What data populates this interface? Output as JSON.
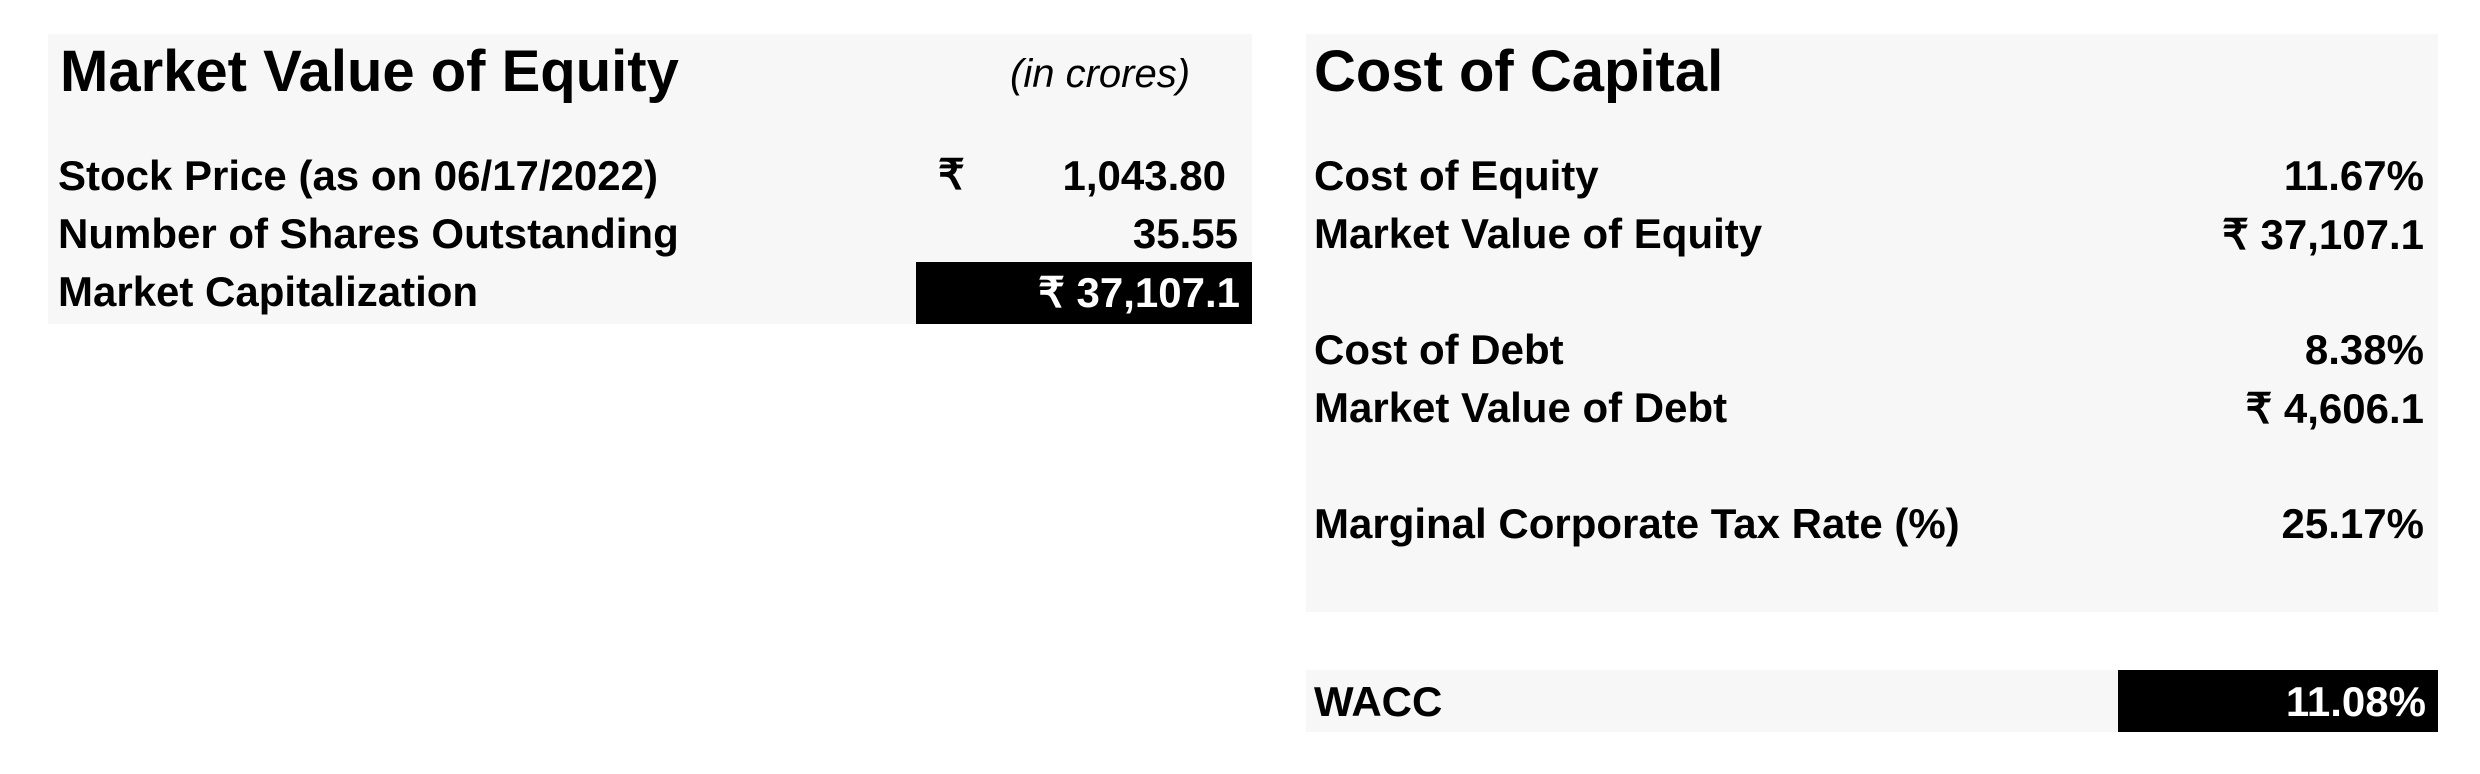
{
  "equity": {
    "title": "Market Value of Equity",
    "unit_note": "(in crores)",
    "rows": [
      {
        "label": "Stock Price (as on 06/17/2022)",
        "currency": "₹",
        "value": "1,043.80"
      },
      {
        "label": "Number of Shares Outstanding",
        "value": "35.55"
      },
      {
        "label": "Market Capitalization",
        "value": "₹ 37,107.1"
      }
    ]
  },
  "capital": {
    "title": "Cost of Capital",
    "rows": [
      {
        "label": "Cost of Equity",
        "value": "11.67%"
      },
      {
        "label": "Market Value of Equity",
        "value": "₹ 37,107.1"
      },
      {
        "label": "Cost of Debt",
        "value": "8.38%"
      },
      {
        "label": "Market Value of Debt",
        "value": "₹ 4,606.1"
      },
      {
        "label": "Marginal Corporate Tax Rate (%)",
        "value": "25.17%"
      }
    ]
  },
  "wacc": {
    "label": "WACC",
    "value": "11.08%"
  },
  "colors": {
    "panel_bg": "#f7f7f7",
    "highlight_bg": "#000000",
    "highlight_text": "#ffffff"
  }
}
